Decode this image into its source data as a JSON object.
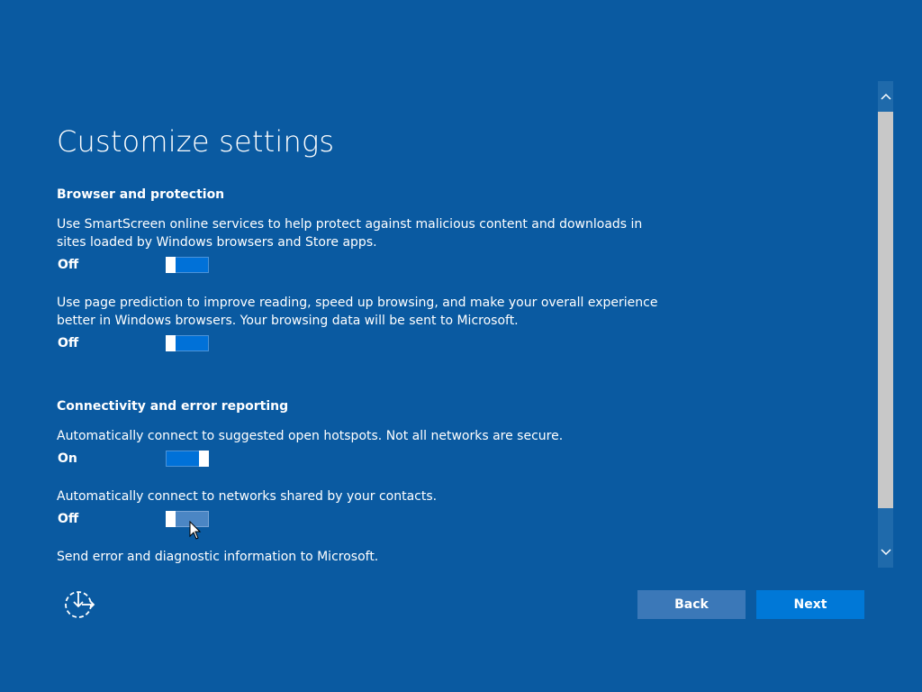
{
  "page": {
    "title": "Customize settings"
  },
  "browser_section": {
    "heading": "Browser and protection",
    "settings": [
      {
        "description": "Use SmartScreen online services to help protect against malicious content and downloads in sites loaded by Windows browsers and Store apps.",
        "state": "Off"
      },
      {
        "description": "Use page prediction to improve reading, speed up browsing, and make your overall experience better in Windows browsers. Your browsing data will be sent to Microsoft.",
        "state": "Off"
      }
    ]
  },
  "connectivity_section": {
    "heading": "Connectivity and error reporting",
    "settings": [
      {
        "description": "Automatically connect to suggested open hotspots. Not all networks are secure.",
        "state": "On"
      },
      {
        "description": "Automatically connect to networks shared by your contacts.",
        "state": "Off"
      },
      {
        "description": "Send error and diagnostic information to Microsoft."
      }
    ]
  },
  "buttons": {
    "back": "Back",
    "next": "Next"
  },
  "icons": {
    "ease_of_access": "ease-of-access-icon",
    "scroll_up": "chevron-up-icon",
    "scroll_down": "chevron-down-icon",
    "cursor": "mouse-pointer-icon"
  },
  "colors": {
    "background": "#0a5aa1",
    "toggle_fill": "#0071d8",
    "next_button": "#0078d7",
    "back_button": "#3b78b8"
  }
}
